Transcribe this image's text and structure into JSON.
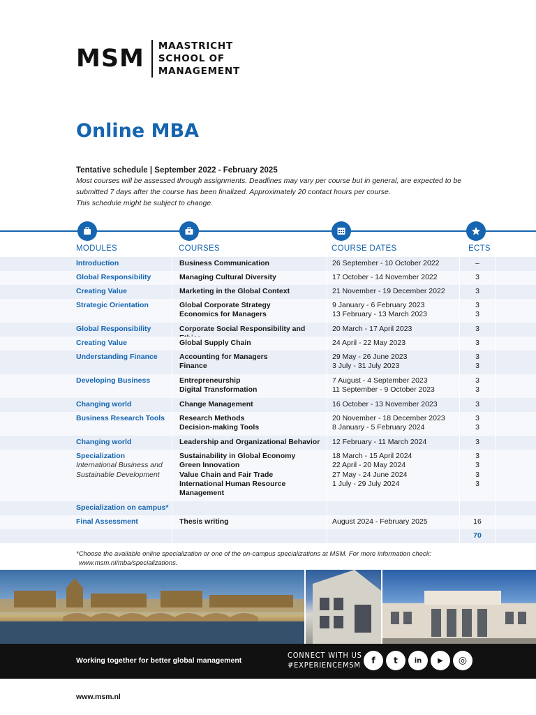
{
  "logo": {
    "mark": "MSM",
    "line1": "MAASTRICHT",
    "line2": "SCHOOL OF",
    "line3": "MANAGEMENT"
  },
  "title": "Online MBA",
  "schedule_heading": "Tentative schedule | September 2022 - February 2025",
  "description": {
    "line1": "Most courses will be assessed through assignments. Deadlines may vary per course but in general, are expected to be",
    "line2": "submitted 7 days after the course has been finalized. Approximately 20 contact hours per course.",
    "line3": "This schedule might be subject to change."
  },
  "icons": [
    "modules-icon",
    "courses-icon",
    "calendar-icon",
    "star-icon"
  ],
  "columns": {
    "modules": "MODULES",
    "courses": "COURSES",
    "dates": "COURSE DATES",
    "ects": "ECTS"
  },
  "rows": [
    {
      "module": "Introduction",
      "courses": [
        "Business Communication"
      ],
      "dates": [
        "26 September - 10 October 2022"
      ],
      "ects": [
        "–"
      ]
    },
    {
      "module": "Global Responsibility",
      "courses": [
        "Managing Cultural Diversity"
      ],
      "dates": [
        "17 October - 14 November 2022"
      ],
      "ects": [
        "3"
      ]
    },
    {
      "module": "Creating Value",
      "courses": [
        "Marketing in the Global Context"
      ],
      "dates": [
        "21 November - 19 December 2022"
      ],
      "ects": [
        "3"
      ]
    },
    {
      "module": "Strategic Orientation",
      "courses": [
        "Global Corporate Strategy",
        "Economics for Managers"
      ],
      "dates": [
        "9 January - 6 February 2023",
        "13 February - 13 March 2023"
      ],
      "ects": [
        "3",
        "3"
      ]
    },
    {
      "module": "Global Responsibility",
      "courses": [
        "Corporate Social Responsibility and Ethics"
      ],
      "dates": [
        "20 March - 17 April 2023"
      ],
      "ects": [
        "3"
      ]
    },
    {
      "module": "Creating Value",
      "courses": [
        "Global Supply Chain"
      ],
      "dates": [
        "24 April - 22 May 2023"
      ],
      "ects": [
        "3"
      ]
    },
    {
      "module": "Understanding Finance",
      "courses": [
        "Accounting for Managers",
        "Finance"
      ],
      "dates": [
        "29 May - 26 June 2023",
        "3 July - 31 July 2023"
      ],
      "ects": [
        "3",
        "3"
      ]
    },
    {
      "module": "Developing Business",
      "courses": [
        "Entrepreneurship",
        "Digital Transformation"
      ],
      "dates": [
        "7 August - 4 September 2023",
        "11 September - 9 October 2023"
      ],
      "ects": [
        "3",
        "3"
      ]
    },
    {
      "module": "Changing world",
      "courses": [
        "Change Management"
      ],
      "dates": [
        "16 October - 13 November 2023"
      ],
      "ects": [
        "3"
      ]
    },
    {
      "module": "Business Research Tools",
      "courses": [
        "Research Methods",
        "Decision-making Tools"
      ],
      "dates": [
        "20 November - 18 December 2023",
        "8 January - 5 February 2024"
      ],
      "ects": [
        "3",
        "3"
      ]
    },
    {
      "module": "Changing world",
      "courses": [
        "Leadership and Organizational Behavior"
      ],
      "dates": [
        "12 February - 11 March 2024"
      ],
      "ects": [
        "3"
      ]
    },
    {
      "module": "Specialization",
      "module_sub": [
        "International Business and",
        "Sustainable Development"
      ],
      "courses": [
        "Sustainability in Global Economy",
        "Green Innovation",
        "Value Chain and Fair Trade",
        "International Human Resource",
        "Management"
      ],
      "dates": [
        "18 March - 15 April 2024",
        "22 April - 20 May 2024",
        "27 May - 24 June 2024",
        "1 July - 29 July 2024"
      ],
      "ects": [
        "3",
        "3",
        "3",
        "3"
      ]
    },
    {
      "module": "Specialization on campus*",
      "courses": [],
      "dates": [],
      "ects": []
    },
    {
      "module": "Final Assessment",
      "courses": [
        "Thesis writing"
      ],
      "dates": [
        "August 2024 - February 2025"
      ],
      "ects": [
        "16"
      ]
    },
    {
      "module": "",
      "courses": [],
      "dates": [],
      "ects": [
        "70"
      ],
      "total": true
    }
  ],
  "footnote": {
    "line1": "*Choose the available online specialization or one of the on-campus specializations at MSM. For more information check:",
    "line2": "www.msm.nl/mba/specializations."
  },
  "footer": {
    "tagline": "Working together for better global management",
    "connect_line1": "CONNECT WITH US",
    "connect_line2": "#EXPERIENCEMSM",
    "social": [
      {
        "name": "facebook-icon",
        "glyph": "f"
      },
      {
        "name": "twitter-icon",
        "glyph": "t"
      },
      {
        "name": "linkedin-icon",
        "glyph": "in"
      },
      {
        "name": "youtube-icon",
        "glyph": "▶"
      },
      {
        "name": "instagram-icon",
        "glyph": "◎"
      }
    ]
  },
  "url": "www.msm.nl"
}
